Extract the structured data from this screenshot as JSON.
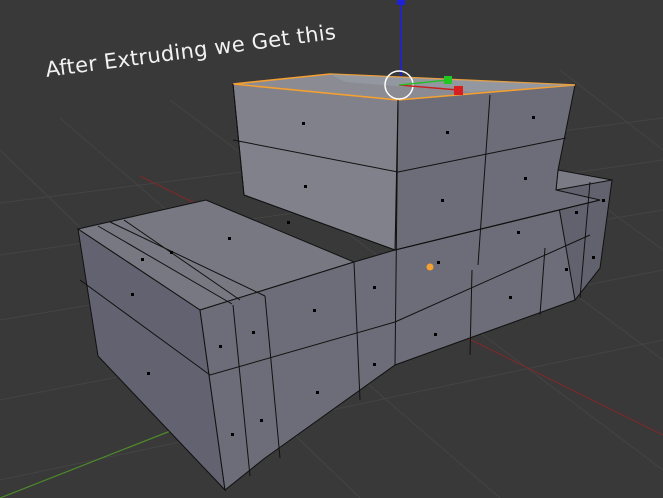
{
  "viewport": {
    "annotation_text": "After Extruding we Get this",
    "background_color": "#393939",
    "grid_color": "#454545",
    "mesh_face_color": "#72727c",
    "mesh_edge_color": "#111111",
    "selected_face_color": "#f4a032",
    "x_axis_color": "#8a2c2c",
    "y_axis_color": "#4f8a2a",
    "z_axis_color": "#1b1bd6"
  },
  "widgets": {
    "manipulator": "transform-manipulator-icon",
    "cursor": "3d-cursor-icon",
    "origin": "object-origin-icon"
  }
}
